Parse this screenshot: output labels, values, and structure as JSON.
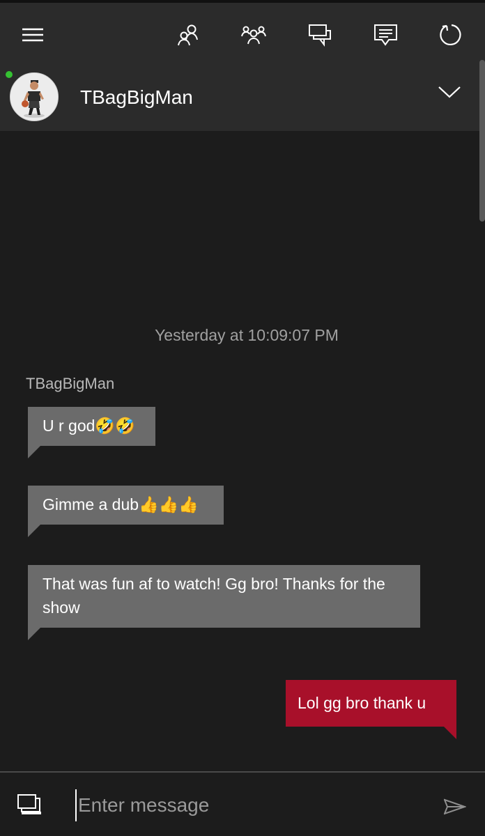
{
  "header": {
    "icons": [
      "menu-icon",
      "friends-icon",
      "party-icon",
      "conversations-icon",
      "messages-icon",
      "refresh-icon"
    ],
    "gamertag": "TBagBigMan",
    "presence_color": "#35c132"
  },
  "conversation": {
    "timestamp": "Yesterday at 10:09:07 PM",
    "sender_name": "TBagBigMan",
    "messages": [
      {
        "from": "them",
        "text": "U r god🤣🤣"
      },
      {
        "from": "them",
        "text": "Gimme a dub👍👍👍"
      },
      {
        "from": "them",
        "text": "That was fun af to watch! Gg bro! Thanks for the show"
      },
      {
        "from": "me",
        "text": "Lol gg bro thank u"
      }
    ]
  },
  "composer": {
    "placeholder": "Enter message",
    "value": ""
  },
  "colors": {
    "background": "#1c1c1c",
    "header": "#2b2b2b",
    "incoming_bubble": "#6b6b6b",
    "outgoing_bubble": "#a8102a"
  }
}
